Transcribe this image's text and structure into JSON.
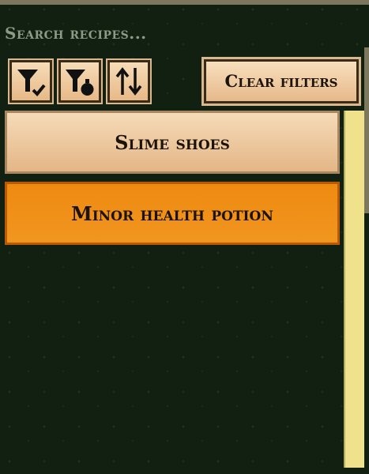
{
  "search": {
    "placeholder": "Search recipes..."
  },
  "toolbar": {
    "clear_label": "Clear filters"
  },
  "recipes": [
    {
      "label": "Slime shoes",
      "selected": false
    },
    {
      "label": "Minor health potion",
      "selected": true
    }
  ],
  "icons": [
    "filter-check-icon",
    "filter-potion-icon",
    "sort-icon"
  ],
  "colors": {
    "selected": "#f0901a",
    "item": "#f0d2ae",
    "scrollbar": "#efe28a"
  }
}
